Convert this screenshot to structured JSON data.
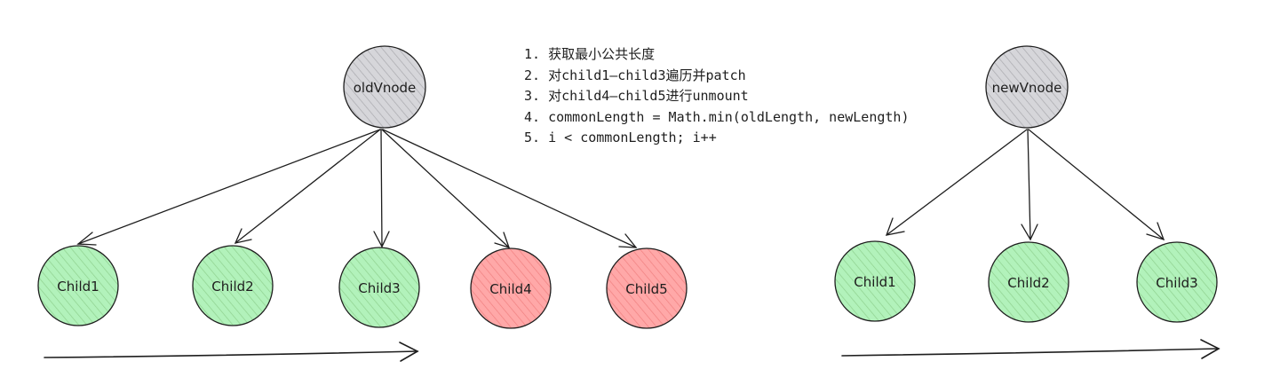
{
  "colors": {
    "stroke": "#1e1e1e",
    "root_fill": "#cfcfd3",
    "keep_fill": "#b2f2bb",
    "remove_fill": "#ffa8a8",
    "hatch_keep": "#8fd18f",
    "hatch_remove": "#f08080",
    "hatch_root": "#a9a9ae"
  },
  "old_tree": {
    "root": "oldVnode",
    "children": [
      {
        "label": "Child1",
        "status": "keep"
      },
      {
        "label": "Child2",
        "status": "keep"
      },
      {
        "label": "Child3",
        "status": "keep"
      },
      {
        "label": "Child4",
        "status": "remove"
      },
      {
        "label": "Child5",
        "status": "remove"
      }
    ]
  },
  "new_tree": {
    "root": "newVnode",
    "children": [
      {
        "label": "Child1",
        "status": "keep"
      },
      {
        "label": "Child2",
        "status": "keep"
      },
      {
        "label": "Child3",
        "status": "keep"
      }
    ]
  },
  "notes": [
    "1. 获取最小公共长度",
    "2. 对child1—child3遍历并patch",
    "3. 对child4—child5进行unmount",
    "4. commonLength = Math.min(oldLength, newLength)",
    "5. i < commonLength; i++"
  ]
}
